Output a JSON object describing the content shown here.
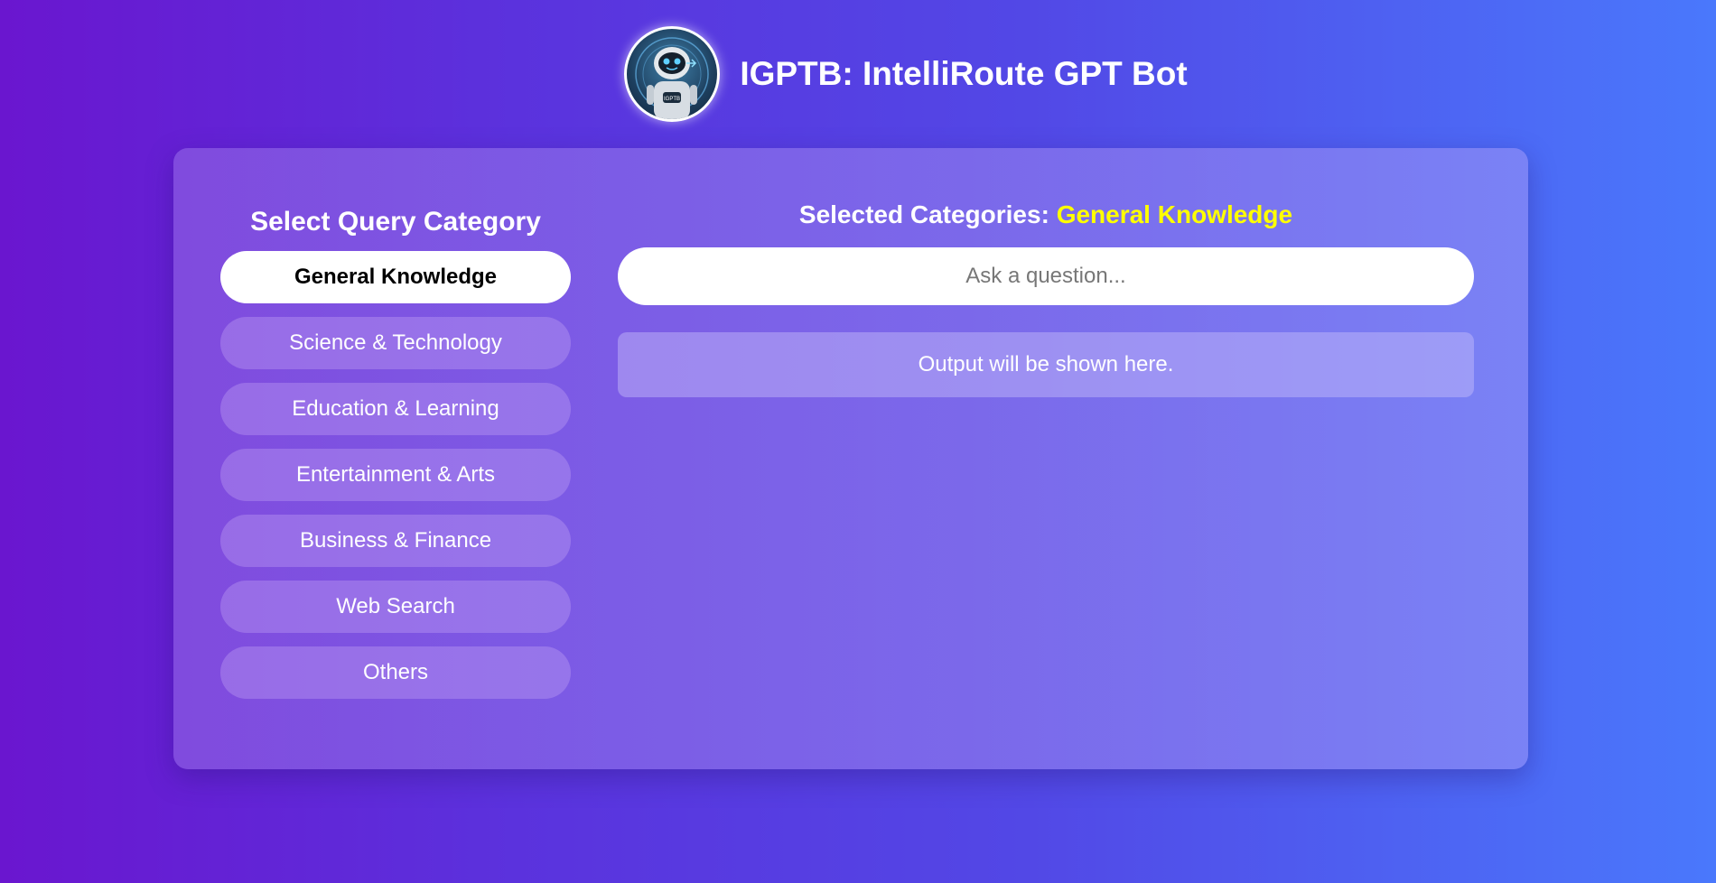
{
  "header": {
    "title": "IGPTB: IntelliRoute GPT Bot",
    "avatar_badge": "IGPTB",
    "avatar_icon": "robot-icon"
  },
  "sidebar": {
    "title": "Select Query Category",
    "categories": [
      {
        "label": "General Knowledge",
        "active": true
      },
      {
        "label": "Science & Technology",
        "active": false
      },
      {
        "label": "Education & Learning",
        "active": false
      },
      {
        "label": "Entertainment & Arts",
        "active": false
      },
      {
        "label": "Business & Finance",
        "active": false
      },
      {
        "label": "Web Search",
        "active": false
      },
      {
        "label": "Others",
        "active": false
      }
    ]
  },
  "main": {
    "selected_label": "Selected Categories:",
    "selected_value": "General Knowledge",
    "input_placeholder": "Ask a question...",
    "input_value": "",
    "output_text": "Output will be shown here."
  },
  "colors": {
    "accent_selected": "#ffff00",
    "active_button_bg": "#ffffff",
    "text": "#ffffff"
  }
}
